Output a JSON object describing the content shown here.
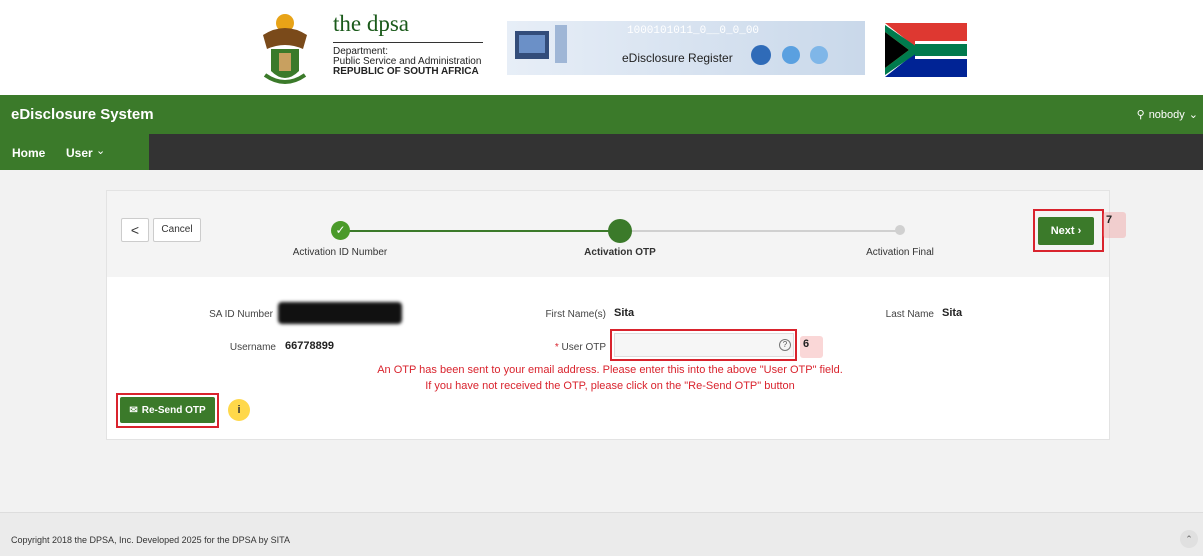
{
  "header": {
    "dpsa_title": "the dpsa",
    "dpsa_line1": "Department:",
    "dpsa_line2": "Public Service and Administration",
    "dpsa_line3": "REPUBLIC OF SOUTH AFRICA",
    "register_text": "eDisclosure Register"
  },
  "topbar": {
    "app_title": "eDisclosure System",
    "user": "nobody"
  },
  "nav": {
    "home": "Home",
    "user": "User"
  },
  "wizard": {
    "back": "<",
    "cancel": "Cancel",
    "steps": [
      "Activation ID Number",
      "Activation OTP",
      "Activation Final"
    ],
    "next": "Next"
  },
  "form": {
    "sa_id_label": "SA ID Number",
    "username_label": "Username",
    "username_value": "66778899",
    "first_name_label": "First Name(s)",
    "first_name_value": "Sita",
    "last_name_label": "Last Name",
    "last_name_value": "Sita",
    "otp_label": "User OTP",
    "otp_required": "*",
    "message_line1": "An OTP has been sent to your email address. Please enter this into the above \"User OTP\" field.",
    "message_line2": "If you have not received the OTP, please click on the \"Re-Send OTP\" button",
    "resend": "Re-Send OTP"
  },
  "callouts": {
    "next": "7",
    "otp": "6",
    "resend": "i"
  },
  "footer": {
    "copyright": "Copyright 2018 the DPSA, Inc. Developed 2025 for the DPSA by SITA"
  },
  "colors": {
    "brand_green": "#3b7a2a",
    "nav_dark": "#333333",
    "alert_red": "#d9232d"
  }
}
